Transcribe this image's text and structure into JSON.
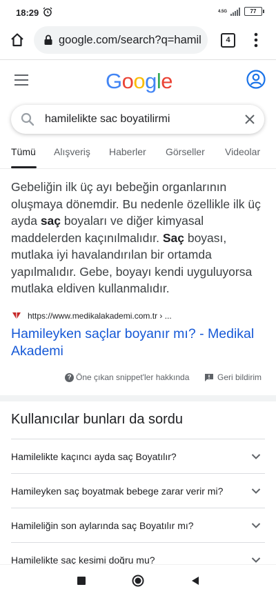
{
  "status": {
    "time": "18:29",
    "network": "4.5G",
    "battery": "77"
  },
  "browser": {
    "url": "google.com/search?q=hamil",
    "tab_count": "4"
  },
  "search": {
    "query": "hamilelikte sac boyatilirmi"
  },
  "tabs": [
    "Tümü",
    "Alışveriş",
    "Haberler",
    "Görseller",
    "Videolar"
  ],
  "snippet": {
    "s1": "Gebeliğin ilk üç ayı bebeğin organlarının oluşmaya dönemdir. Bu nedenle özellikle ilk üç ayda ",
    "b1": "saç",
    "s2": " boyaları ve diğer kimyasal maddelerden kaçınılmalıdır. ",
    "b2": "Saç",
    "s3": " boyası, mutlaka iyi havalandırılan bir ortamda yapılmalıdır. Gebe, boyayı kendi uyguluyorsa mutlaka eldiven kullanmalıdır.",
    "source_url": "https://www.medikalakademi.com.tr › ...",
    "title": "Hamileyken saçlar boyanır mı? - Medikal Akademi",
    "about_label": "Öne çıkan snippet'ler hakkında",
    "feedback_label": "Geri bildirim"
  },
  "paa": {
    "title": "Kullanıcılar bunları da sordu",
    "items": [
      "Hamilelikte kaçıncı ayda saç Boyatılır?",
      "Hamileyken saç boyatmak bebege zarar verir mi?",
      "Hamileliğin son aylarında saç Boyatılır mı?",
      "Hamilelikte saç kesimi doğru mu?"
    ]
  },
  "colors": {
    "link": "#1558d6",
    "g_blue": "#4285f4",
    "g_red": "#ea4335",
    "g_yellow": "#fbbc05",
    "g_green": "#34a853"
  }
}
